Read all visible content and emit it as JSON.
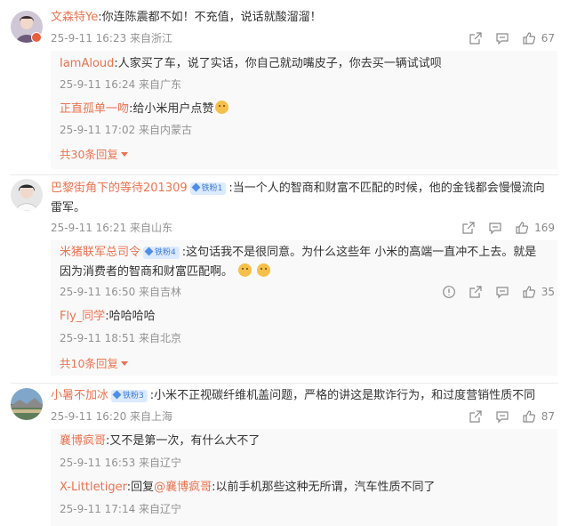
{
  "threads": [
    {
      "user": "文森特Ye",
      "text": ":你连陈震都不如！不充值，说话就酸溜溜！",
      "meta": "25-9-11 16:23 来自浙江",
      "likes": "67",
      "replies": [
        {
          "user": "IamAloud",
          "text": ":人家买了车，说了实话，你自己就动嘴皮子，你去买一辆试试呗",
          "meta": "25-9-11 16:24 来自广东"
        },
        {
          "user": "正直孤单一吻",
          "text": ":给小米用户点赞",
          "emoji": "smile-emoji",
          "meta": "25-9-11 17:02 来自内蒙古"
        }
      ],
      "more": "共30条回复"
    },
    {
      "user": "巴黎街角下的等待201309",
      "badge": "铁粉1",
      "text": ":当一个人的智商和财富不匹配的时候，他的金钱都会慢慢流向",
      "text2": "雷军。",
      "meta": "25-9-11 16:21 来自山东",
      "likes": "169",
      "replies": [
        {
          "user": "米猪联军总司令",
          "badge": "铁粉4",
          "text": ":这句话我不是很同意。为什么这些年 小米的高端一直冲不上去。就是",
          "text2": "因为消费者的智商和财富匹配啊。",
          "meta": "25-9-11 16:50 来自吉林",
          "likes": "35"
        },
        {
          "user": "Fly_同学",
          "text": ":哈哈哈哈",
          "meta": "25-9-11 18:51 来自北京"
        }
      ],
      "more": "共10条回复"
    },
    {
      "user": "小暑不加冰",
      "badge": "铁粉3",
      "text": ":小米不正视碳纤维机盖问题，严格的讲这是欺诈行为，和过度营销性质不同",
      "meta": "25-9-11 16:20 来自上海",
      "likes": "87",
      "replies": [
        {
          "user": "襄博疯哥",
          "text": ":又不是第一次，有什么大不了",
          "meta": "25-9-11 16:53 来自辽宁"
        },
        {
          "user": "X-Littletiger",
          "prefix": ":回复",
          "mention": "@襄博疯哥",
          "text": ":以前手机那些这种无所谓，汽车性质不同了",
          "meta": "25-9-11 17:14 来自辽宁"
        }
      ]
    }
  ],
  "colors": {
    "name": "#eb7350",
    "meta": "#939393",
    "badge_bg": "#dceafe",
    "badge_text": "#3d7bd8",
    "reply_bg": "#f9f9f9"
  }
}
